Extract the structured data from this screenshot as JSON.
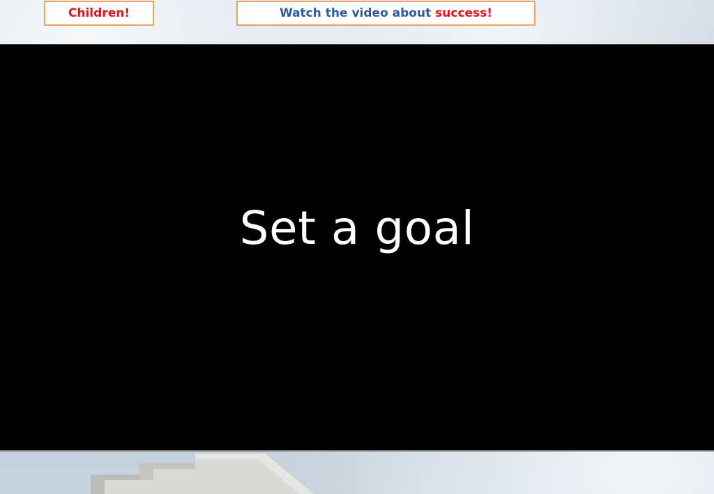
{
  "banners": {
    "children": "Children!",
    "watch_prefix": "Watch the video about ",
    "watch_highlight": "success",
    "watch_suffix": "!"
  },
  "video": {
    "caption": "Set a goal"
  },
  "colors": {
    "banner_border": "#f0a060",
    "red_text": "#e0141e",
    "blue_text": "#2e5b9a",
    "video_bg": "#000000",
    "caption_text": "#ffffff"
  }
}
